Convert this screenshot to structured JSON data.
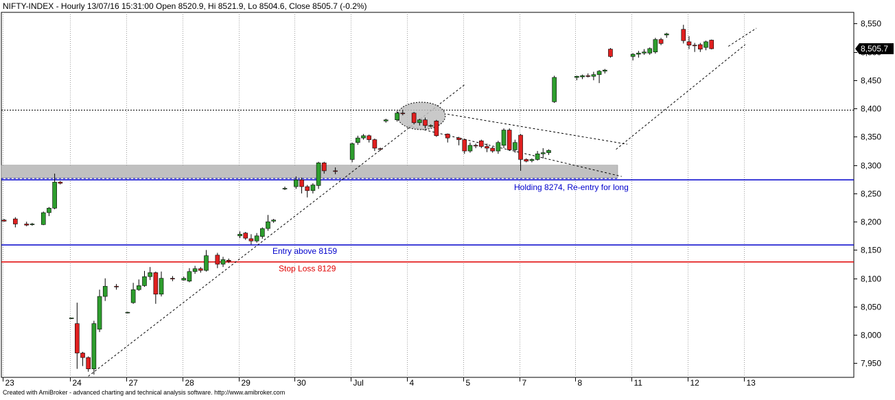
{
  "header": {
    "title": "NIFTY-INDEX - Hourly 13/07/16 15:31:00 Open 8520.9, Hi 8521.9, Lo 8504.6, Close 8505.7 (-0.2%)"
  },
  "footer": {
    "text": "Created with AmiBroker - advanced charting and technical analysis software. http://www.amibroker.com"
  },
  "chart_data": {
    "type": "candlestick",
    "title": "NIFTY-INDEX - Hourly 13/07/16 15:31:00 Open 8520.9, Hi 8521.9, Lo 8504.6, Close 8505.7 (-0.2%)",
    "ylim": [
      7925,
      8570
    ],
    "y_ticks": [
      7950,
      8000,
      8050,
      8100,
      8150,
      8200,
      8250,
      8300,
      8350,
      8400,
      8450,
      8500,
      8550
    ],
    "y_tick_labels": [
      "7,950",
      "8,000",
      "8,050",
      "8,100",
      "8,150",
      "8,200",
      "8,250",
      "8,300",
      "8,350",
      "8,400",
      "8,450",
      "8,500",
      "8,550"
    ],
    "x_day_labels": [
      "23",
      "24",
      "27",
      "28",
      "29",
      "30",
      "Jul",
      "4",
      "5",
      "7",
      "8",
      "11",
      "12",
      "13"
    ],
    "x_day_start_index": [
      0,
      12,
      22,
      32,
      42,
      52,
      62,
      72,
      82,
      92,
      102,
      112,
      122,
      132
    ],
    "grid": "vertical dotted at each day",
    "last_price_label": "8,505.7",
    "colors": {
      "up": "#2e9e2e",
      "down": "#e02020",
      "wick": "#000000",
      "entry_line": "#0000cc",
      "stop_line": "#e00000",
      "zone": "#c0c0c0"
    },
    "annotations": {
      "holding_label": "Holding 8274, Re-entry for long",
      "holding_level": 8274,
      "entry_label": "Entry above 8159",
      "entry_level": 8159,
      "stop_label": "Stop Loss 8129",
      "stop_level": 8129,
      "resistance_level": 8398,
      "zone_top": 8300,
      "zone_bottom": 8277
    },
    "candles": [
      {
        "o": 8203,
        "h": 8205,
        "l": 8200,
        "c": 8201
      },
      {
        "o": 8205,
        "h": 8208,
        "l": 8190,
        "c": 8196
      },
      {
        "o": 8196,
        "h": 8200,
        "l": 8192,
        "c": 8194
      },
      {
        "o": 8195,
        "h": 8198,
        "l": 8193,
        "c": 8196
      },
      {
        "o": 8195,
        "h": 8218,
        "l": 8194,
        "c": 8216
      },
      {
        "o": 8216,
        "h": 8226,
        "l": 8210,
        "c": 8224
      },
      {
        "o": 8224,
        "h": 8285,
        "l": 8222,
        "c": 8270
      },
      {
        "o": 8270,
        "h": 8272,
        "l": 8266,
        "c": 8268
      },
      {
        "o": 8029,
        "h": 8030,
        "l": 8028,
        "c": 8030
      },
      {
        "o": 8020,
        "h": 8057,
        "l": 7940,
        "c": 7968
      },
      {
        "o": 7968,
        "h": 7970,
        "l": 7945,
        "c": 7960
      },
      {
        "o": 7960,
        "h": 7962,
        "l": 7935,
        "c": 7940
      },
      {
        "o": 7940,
        "h": 8025,
        "l": 7930,
        "c": 8020
      },
      {
        "o": 8010,
        "h": 8080,
        "l": 8005,
        "c": 8068
      },
      {
        "o": 8068,
        "h": 8100,
        "l": 8060,
        "c": 8086
      },
      {
        "o": 8086,
        "h": 8090,
        "l": 8080,
        "c": 8085
      },
      {
        "o": 8039,
        "h": 8041,
        "l": 8038,
        "c": 8040
      },
      {
        "o": 8057,
        "h": 8092,
        "l": 8055,
        "c": 8080
      },
      {
        "o": 8080,
        "h": 8098,
        "l": 8078,
        "c": 8087
      },
      {
        "o": 8087,
        "h": 8113,
        "l": 8085,
        "c": 8103
      },
      {
        "o": 8103,
        "h": 8120,
        "l": 8097,
        "c": 8110
      },
      {
        "o": 8110,
        "h": 8112,
        "l": 8055,
        "c": 8072
      },
      {
        "o": 8072,
        "h": 8112,
        "l": 8068,
        "c": 8100
      },
      {
        "o": 8100,
        "h": 8104,
        "l": 8095,
        "c": 8099
      },
      {
        "o": 8097,
        "h": 8103,
        "l": 8096,
        "c": 8100
      },
      {
        "o": 8095,
        "h": 8118,
        "l": 8093,
        "c": 8112
      },
      {
        "o": 8112,
        "h": 8122,
        "l": 8108,
        "c": 8117
      },
      {
        "o": 8117,
        "h": 8120,
        "l": 8110,
        "c": 8114
      },
      {
        "o": 8114,
        "h": 8150,
        "l": 8112,
        "c": 8140
      },
      {
        "o": 8141,
        "h": 8145,
        "l": 8118,
        "c": 8125
      },
      {
        "o": 8125,
        "h": 8138,
        "l": 8120,
        "c": 8133
      },
      {
        "o": 8132,
        "h": 8135,
        "l": 8127,
        "c": 8130
      },
      {
        "o": 8175,
        "h": 8183,
        "l": 8171,
        "c": 8178
      },
      {
        "o": 8180,
        "h": 8182,
        "l": 8168,
        "c": 8171
      },
      {
        "o": 8170,
        "h": 8178,
        "l": 8160,
        "c": 8166
      },
      {
        "o": 8166,
        "h": 8180,
        "l": 8163,
        "c": 8175
      },
      {
        "o": 8174,
        "h": 8190,
        "l": 8170,
        "c": 8188
      },
      {
        "o": 8188,
        "h": 8212,
        "l": 8184,
        "c": 8200
      },
      {
        "o": 8201,
        "h": 8205,
        "l": 8198,
        "c": 8203
      },
      {
        "o": 8258,
        "h": 8262,
        "l": 8256,
        "c": 8259
      },
      {
        "o": 8262,
        "h": 8280,
        "l": 8258,
        "c": 8274
      },
      {
        "o": 8274,
        "h": 8278,
        "l": 8250,
        "c": 8262
      },
      {
        "o": 8262,
        "h": 8265,
        "l": 8243,
        "c": 8255
      },
      {
        "o": 8255,
        "h": 8268,
        "l": 8250,
        "c": 8265
      },
      {
        "o": 8264,
        "h": 8306,
        "l": 8258,
        "c": 8304
      },
      {
        "o": 8304,
        "h": 8306,
        "l": 8285,
        "c": 8290
      },
      {
        "o": 8290,
        "h": 8296,
        "l": 8284,
        "c": 8289
      },
      {
        "o": 8310,
        "h": 8340,
        "l": 8305,
        "c": 8338
      },
      {
        "o": 8340,
        "h": 8352,
        "l": 8336,
        "c": 8348
      },
      {
        "o": 8348,
        "h": 8355,
        "l": 8345,
        "c": 8352
      },
      {
        "o": 8352,
        "h": 8354,
        "l": 8340,
        "c": 8345
      },
      {
        "o": 8345,
        "h": 8347,
        "l": 8325,
        "c": 8330
      },
      {
        "o": 8329,
        "h": 8331,
        "l": 8325,
        "c": 8328
      },
      {
        "o": 8378,
        "h": 8382,
        "l": 8375,
        "c": 8380
      },
      {
        "o": 8380,
        "h": 8396,
        "l": 8377,
        "c": 8392
      },
      {
        "o": 8392,
        "h": 8398,
        "l": 8388,
        "c": 8391
      },
      {
        "o": 8392,
        "h": 8394,
        "l": 8372,
        "c": 8375
      },
      {
        "o": 8375,
        "h": 8382,
        "l": 8370,
        "c": 8380
      },
      {
        "o": 8380,
        "h": 8384,
        "l": 8365,
        "c": 8370
      },
      {
        "o": 8370,
        "h": 8372,
        "l": 8367,
        "c": 8370
      },
      {
        "o": 8378,
        "h": 8380,
        "l": 8350,
        "c": 8352
      },
      {
        "o": 8355,
        "h": 8356,
        "l": 8340,
        "c": 8348
      },
      {
        "o": 8348,
        "h": 8350,
        "l": 8335,
        "c": 8345
      },
      {
        "o": 8345,
        "h": 8347,
        "l": 8320,
        "c": 8325
      },
      {
        "o": 8325,
        "h": 8340,
        "l": 8322,
        "c": 8335
      },
      {
        "o": 8335,
        "h": 8338,
        "l": 8330,
        "c": 8334
      },
      {
        "o": 8343,
        "h": 8345,
        "l": 8330,
        "c": 8333
      },
      {
        "o": 8333,
        "h": 8338,
        "l": 8323,
        "c": 8330
      },
      {
        "o": 8330,
        "h": 8333,
        "l": 8322,
        "c": 8325
      },
      {
        "o": 8325,
        "h": 8343,
        "l": 8320,
        "c": 8340
      },
      {
        "o": 8335,
        "h": 8365,
        "l": 8330,
        "c": 8362
      },
      {
        "o": 8362,
        "h": 8365,
        "l": 8325,
        "c": 8327
      },
      {
        "o": 8327,
        "h": 8345,
        "l": 8322,
        "c": 8340
      },
      {
        "o": 8353,
        "h": 8355,
        "l": 8290,
        "c": 8310
      },
      {
        "o": 8310,
        "h": 8312,
        "l": 8305,
        "c": 8307
      },
      {
        "o": 8308,
        "h": 8312,
        "l": 8305,
        "c": 8310
      },
      {
        "o": 8310,
        "h": 8325,
        "l": 8308,
        "c": 8320
      },
      {
        "o": 8320,
        "h": 8330,
        "l": 8312,
        "c": 8322
      },
      {
        "o": 8322,
        "h": 8328,
        "l": 8318,
        "c": 8326
      },
      {
        "o": 8412,
        "h": 8458,
        "l": 8410,
        "c": 8455
      },
      {
        "o": 8455,
        "h": 8458,
        "l": 8450,
        "c": 8457
      },
      {
        "o": 8456,
        "h": 8460,
        "l": 8452,
        "c": 8458
      },
      {
        "o": 8458,
        "h": 8462,
        "l": 8455,
        "c": 8457
      },
      {
        "o": 8457,
        "h": 8465,
        "l": 8450,
        "c": 8460
      },
      {
        "o": 8460,
        "h": 8468,
        "l": 8445,
        "c": 8466
      },
      {
        "o": 8466,
        "h": 8470,
        "l": 8462,
        "c": 8468
      },
      {
        "o": 8505,
        "h": 8507,
        "l": 8490,
        "c": 8492
      },
      {
        "o": 8492,
        "h": 8498,
        "l": 8485,
        "c": 8496
      },
      {
        "o": 8496,
        "h": 8502,
        "l": 8490,
        "c": 8498
      },
      {
        "o": 8498,
        "h": 8505,
        "l": 8495,
        "c": 8500
      },
      {
        "o": 8498,
        "h": 8508,
        "l": 8495,
        "c": 8506
      },
      {
        "o": 8500,
        "h": 8525,
        "l": 8497,
        "c": 8522
      },
      {
        "o": 8522,
        "h": 8525,
        "l": 8512,
        "c": 8515
      },
      {
        "o": 8530,
        "h": 8534,
        "l": 8525,
        "c": 8532
      },
      {
        "o": 8540,
        "h": 8548,
        "l": 8515,
        "c": 8520
      },
      {
        "o": 8518,
        "h": 8528,
        "l": 8505,
        "c": 8512
      },
      {
        "o": 8512,
        "h": 8516,
        "l": 8500,
        "c": 8511
      },
      {
        "o": 8513,
        "h": 8516,
        "l": 8500,
        "c": 8505
      },
      {
        "o": 8508,
        "h": 8520,
        "l": 8503,
        "c": 8518
      },
      {
        "o": 8520.9,
        "h": 8521.9,
        "l": 8504.6,
        "c": 8505.7
      }
    ],
    "candle_index": [
      0,
      2,
      4,
      5,
      7,
      8,
      9,
      10,
      12,
      13,
      14,
      15,
      16,
      17,
      18,
      20,
      22,
      23,
      24,
      25,
      26,
      27,
      28,
      30,
      32,
      33,
      34,
      35,
      36,
      38,
      39,
      40,
      42,
      43,
      44,
      45,
      46,
      47,
      48,
      50,
      52,
      53,
      54,
      55,
      56,
      57,
      59,
      62,
      63,
      64,
      65,
      66,
      67,
      68,
      70,
      71,
      73,
      74,
      75,
      76,
      77,
      79,
      81,
      82,
      83,
      84,
      85,
      86,
      87,
      88,
      89,
      90,
      91,
      92,
      93,
      94,
      95,
      96,
      97,
      98,
      102,
      103,
      104,
      105,
      106,
      107,
      108,
      112,
      113,
      114,
      115,
      116,
      117,
      118,
      121,
      122,
      123,
      124,
      125,
      126,
      127,
      128,
      129,
      130,
      131,
      132,
      133,
      134,
      135,
      136
    ]
  }
}
